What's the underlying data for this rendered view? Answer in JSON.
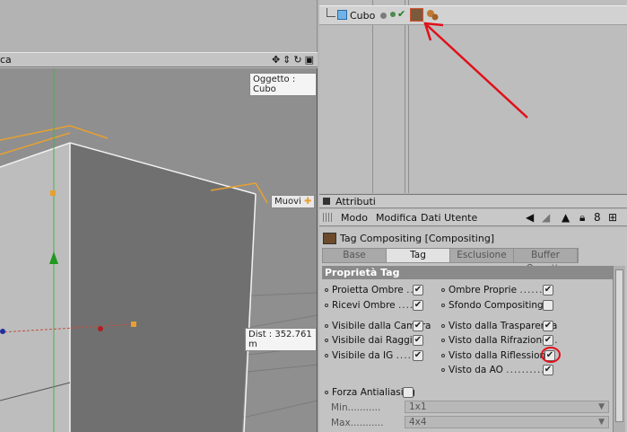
{
  "viewport": {
    "menu_fragment": "ca",
    "object_label": "Oggetto : Cubo",
    "move_label": "Muovi",
    "dist_label": "Dist : 352.761 m",
    "icons": [
      "move-icon",
      "dolly-icon",
      "rotate-icon",
      "maximize-icon"
    ]
  },
  "object_manager": {
    "object_name": "Cubo"
  },
  "attributes": {
    "title": "Attributi",
    "menu": [
      "Modo",
      "Modifica",
      "Dati Utente"
    ],
    "tag_name": "Tag Compositing [Compositing]",
    "tabs": [
      "Base",
      "Tag",
      "Esclusione",
      "Buffer Oggetto"
    ],
    "active_tab": "Tag",
    "section": "Proprietà Tag",
    "left_props": [
      {
        "label": "Proietta Ombre",
        "dots": "....",
        "checked": true
      },
      {
        "label": "Ricevi Ombre",
        "dots": "....",
        "checked": true
      },
      {
        "label": "Visibile dalla Camera",
        "dots": "",
        "checked": true
      },
      {
        "label": "Visibile dai Raggi",
        "dots": "..",
        "checked": true
      },
      {
        "label": "Visibile da IG",
        "dots": "....",
        "checked": true
      }
    ],
    "right_props": [
      {
        "label": "Ombre Proprie",
        "dots": ".......",
        "checked": true
      },
      {
        "label": "Sfondo Compositing",
        "dots": "..",
        "checked": false
      },
      {
        "label": "Visto dalla Trasparenza",
        "dots": "",
        "checked": true
      },
      {
        "label": "Visto dalla Rifrazione",
        "dots": "..",
        "checked": true
      },
      {
        "label": "Visto dalla Riflessione",
        "dots": "",
        "checked": true
      },
      {
        "label": "Visto da AO",
        "dots": "..........",
        "checked": true
      }
    ],
    "antialias": {
      "label": "Forza Antialiasing",
      "checked": false
    },
    "min": {
      "label": "Min",
      "dots": "...........",
      "value": "1x1"
    },
    "max": {
      "label": "Max",
      "dots": "...........",
      "value": "4x4"
    }
  },
  "colors": {
    "highlight": "#e0101a",
    "guide": "#e8a030"
  }
}
